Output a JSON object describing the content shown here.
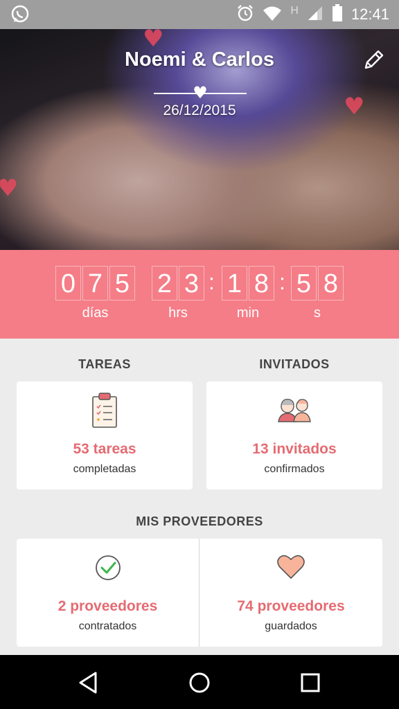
{
  "status_bar": {
    "network_label": "H",
    "time": "12:41"
  },
  "hero": {
    "couple_names": "Noemi & Carlos",
    "wedding_date": "26/12/2015"
  },
  "countdown": {
    "days": [
      "0",
      "7",
      "5"
    ],
    "hours": [
      "2",
      "3"
    ],
    "minutes": [
      "1",
      "8"
    ],
    "seconds": [
      "5",
      "8"
    ],
    "separator": ":",
    "labels": {
      "days": "días",
      "hours": "hrs",
      "minutes": "min",
      "seconds": "s"
    }
  },
  "tareas": {
    "title": "TAREAS",
    "count_text": "53 tareas",
    "sub_text": "completadas"
  },
  "invitados": {
    "title": "INVITADOS",
    "count_text": "13 invitados",
    "sub_text": "confirmados"
  },
  "proveedores": {
    "title": "MIS PROVEEDORES",
    "contracted": {
      "count_text": "2 proveedores",
      "sub_text": "contratados"
    },
    "saved": {
      "count_text": "74 proveedores",
      "sub_text": "guardados"
    }
  },
  "colors": {
    "accent": "#f47d87",
    "accent_text": "#e56b72",
    "check_green": "#3bb54a",
    "heart_peach": "#f7b49a"
  },
  "icons": [
    "whatsapp-icon",
    "alarm-icon",
    "wifi-icon",
    "signal-icon",
    "battery-icon",
    "edit-pencil-icon",
    "clipboard-icon",
    "guests-icon",
    "check-circle-icon",
    "heart-icon",
    "back-icon",
    "home-icon",
    "recents-icon"
  ]
}
